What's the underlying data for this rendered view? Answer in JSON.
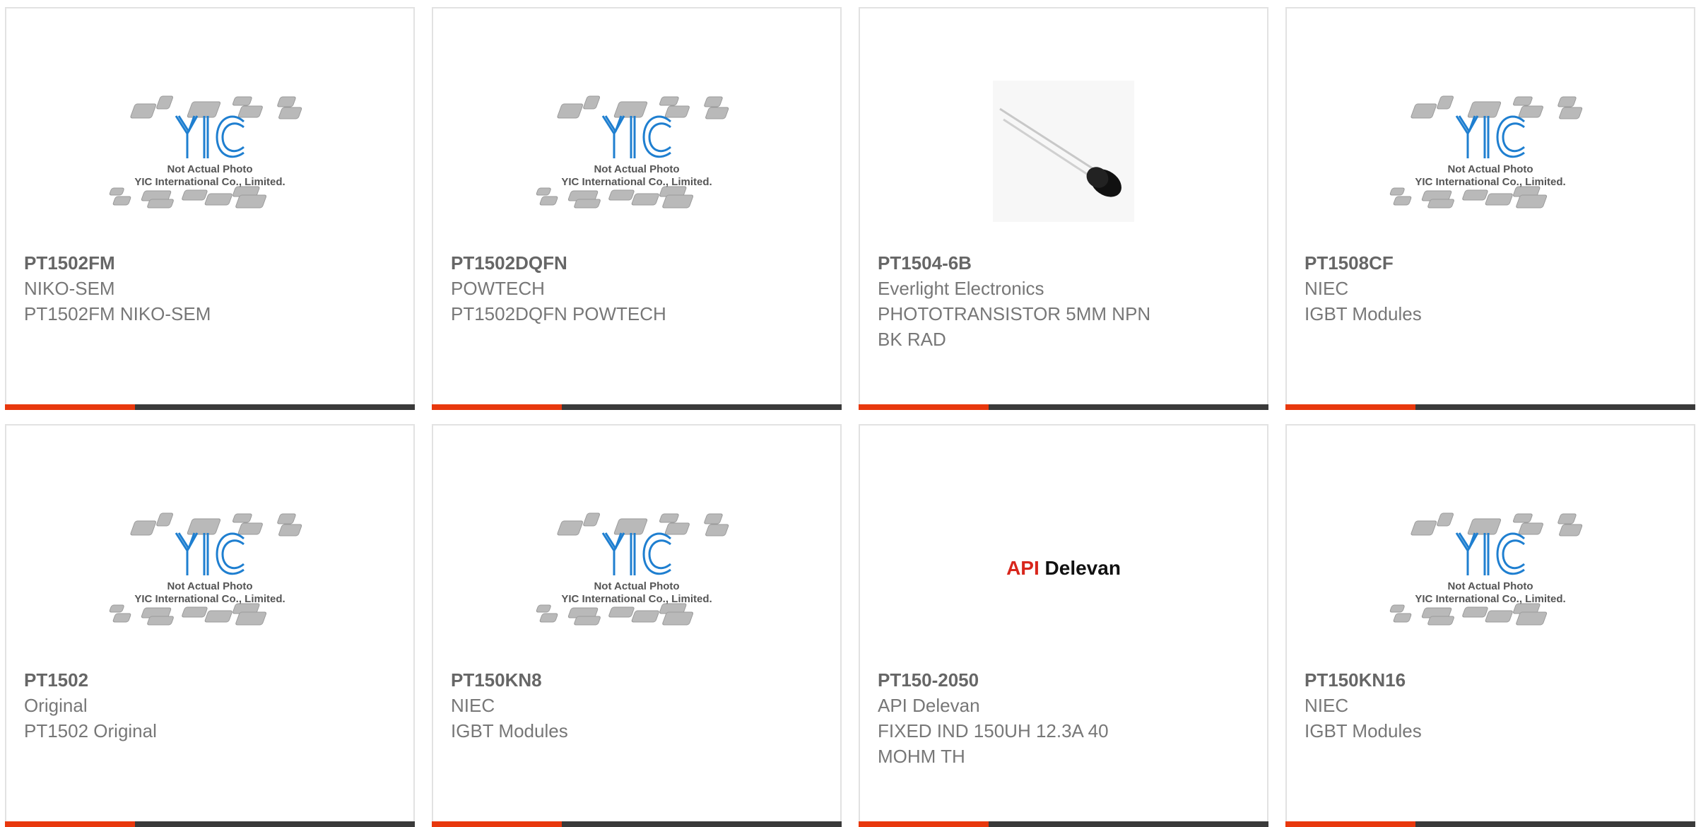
{
  "placeholder": {
    "logo_text": "YIC",
    "caption_line1": "Not Actual Photo",
    "caption_line2": "YIC International Co., Limited."
  },
  "accent_color": "#e8380d",
  "products": [
    {
      "part": "PT1502FM",
      "lines": [
        "NIKO-SEM",
        "PT1502FM NIKO-SEM"
      ],
      "image": "yic-placeholder-icon"
    },
    {
      "part": "PT1502DQFN",
      "lines": [
        "POWTECH",
        "PT1502DQFN POWTECH"
      ],
      "image": "yic-placeholder-icon"
    },
    {
      "part": "PT1504-6B",
      "lines": [
        "Everlight Electronics",
        "PHOTOTRANSISTOR 5MM NPN",
        "BK RAD"
      ],
      "image": "phototransistor-icon"
    },
    {
      "part": "PT1508CF",
      "lines": [
        "NIEC",
        "IGBT Modules"
      ],
      "image": "yic-placeholder-icon"
    },
    {
      "part": "PT1502",
      "lines": [
        "Original",
        "PT1502 Original"
      ],
      "image": "yic-placeholder-icon"
    },
    {
      "part": "PT150KN8",
      "lines": [
        "NIEC",
        "IGBT Modules"
      ],
      "image": "yic-placeholder-icon"
    },
    {
      "part": "PT150-2050",
      "lines": [
        "API Delevan",
        "FIXED IND 150UH 12.3A 40",
        "MOHM TH"
      ],
      "image": "api-delevan-logo",
      "logo_api": "API",
      "logo_delevan": "Delevan"
    },
    {
      "part": "PT150KN16",
      "lines": [
        "NIEC",
        "IGBT Modules"
      ],
      "image": "yic-placeholder-icon"
    }
  ]
}
